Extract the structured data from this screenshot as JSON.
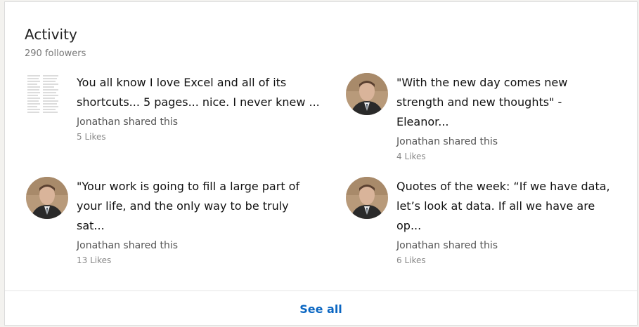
{
  "activity": {
    "title": "Activity",
    "followers": "290 followers",
    "posts": [
      {
        "text": "You all know I love Excel and all of its\nshortcuts... 5 pages... nice. I never knew ...",
        "shared": "Jonathan shared this",
        "likes": "5 Likes",
        "thumb": "document-thumbnail"
      },
      {
        "text": "\"With the new day comes new\nstrength and new thoughts\" -\nEleanor...",
        "shared": "Jonathan shared this",
        "likes": "4 Likes",
        "thumb": "avatar"
      },
      {
        "text": "\"Your work is going to fill a large part of\nyour life, and the only way to be truly\nsat...",
        "shared": "Jonathan shared this",
        "likes": "13 Likes",
        "thumb": "avatar"
      },
      {
        "text": "Quotes of the week: “If we have data,\nlet’s look at data. If all we have are\nop...",
        "shared": "Jonathan shared this",
        "likes": "6 Likes",
        "thumb": "avatar"
      }
    ],
    "see_all": "See all"
  }
}
